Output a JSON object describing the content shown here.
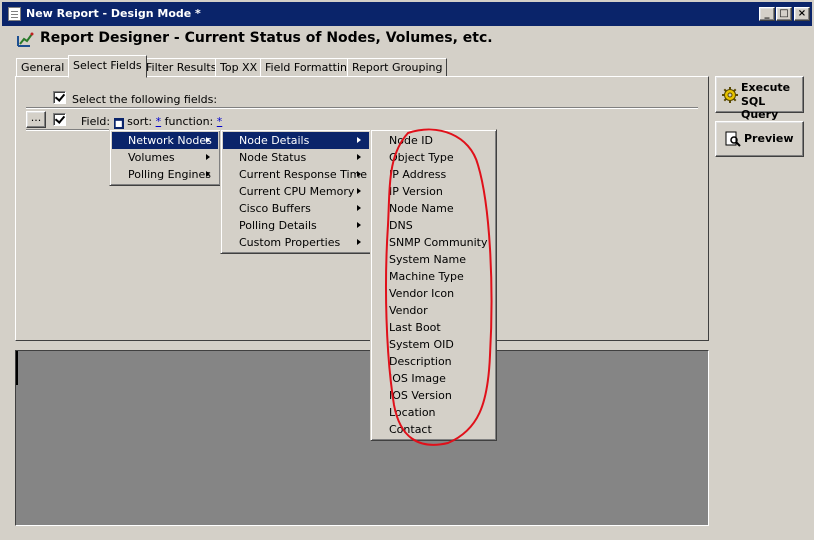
{
  "window": {
    "title": "New Report - Design Mode *",
    "buttons": {
      "minimize": "_",
      "maximize": "□",
      "close": "×"
    }
  },
  "header": {
    "title": "Report Designer - Current Status of Nodes, Volumes, etc."
  },
  "tabs": [
    {
      "label": "General",
      "active": false
    },
    {
      "label": "Select Fields",
      "active": true
    },
    {
      "label": "Filter Results",
      "active": false
    },
    {
      "label": "Top XX",
      "active": false
    },
    {
      "label": "Field Formatting",
      "active": false
    },
    {
      "label": "Report Grouping",
      "active": false
    }
  ],
  "select_fields": {
    "select_all_label": "Select the following fields:",
    "row": {
      "ellipsis": "...",
      "field_label": "Field:",
      "sort_label": "sort:",
      "sort_value": "*",
      "function_label": "function:",
      "function_value": "*"
    }
  },
  "side_buttons": {
    "execute_line1": "Execute",
    "execute_line2": "SQL Query",
    "preview": "Preview"
  },
  "menu_level1": [
    {
      "label": "Network Nodes",
      "highlighted": true
    },
    {
      "label": "Volumes"
    },
    {
      "label": "Polling Engines"
    }
  ],
  "menu_level2": [
    {
      "label": "Node Details",
      "highlighted": true
    },
    {
      "label": "Node Status"
    },
    {
      "label": "Current Response Time"
    },
    {
      "label": "Current CPU  Memory"
    },
    {
      "label": "Cisco Buffers"
    },
    {
      "label": "Polling Details"
    },
    {
      "label": "Custom Properties"
    }
  ],
  "menu_level3": [
    "Node ID",
    "Object Type",
    "IP Address",
    "IP Version",
    "Node Name",
    "DNS",
    "SNMP Community",
    "System Name",
    "Machine Type",
    "Vendor Icon",
    "Vendor",
    "Last Boot",
    "System OID",
    "Description",
    "IOS Image",
    "IOS Version",
    "Location",
    "Contact"
  ],
  "colors": {
    "titlebar": "#0a246a",
    "highlight": "#0a246a",
    "annotation": "#e0101a",
    "preview_area": "#858585"
  }
}
